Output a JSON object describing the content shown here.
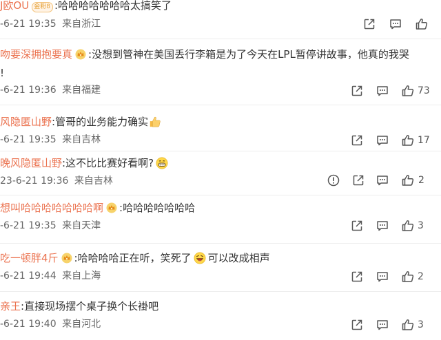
{
  "comments": [
    {
      "username": "J欧OU",
      "badge": "金粉8",
      "text": ":哈哈哈哈哈哈哈太搞笑了",
      "text_after_emoji": "",
      "emoji": "",
      "continuation": "",
      "time": "-6-21 19:35",
      "location": "来自浙江",
      "likes": ""
    },
    {
      "username": "吻要深拥抱要真",
      "badge": "",
      "text": ":没想到管神在美国丢行李箱是为了今天在LPL暂停讲故事，他真的我哭",
      "text_after_emoji": "",
      "emoji": "",
      "continuation": "!",
      "time": "-6-21 19:36",
      "location": "来自福建",
      "likes": "73"
    },
    {
      "username": "风隐匿山野",
      "badge": "",
      "text": ":管哥的业务能力确实",
      "text_after_emoji": "",
      "emoji": "thumbs-up",
      "continuation": "",
      "time": "-6-21 19:35",
      "location": "来自吉林",
      "likes": "17"
    },
    {
      "username": "晚风隐匿山野",
      "badge": "",
      "text": ":这不比比赛好看啊?",
      "text_after_emoji": "",
      "emoji": "grin",
      "continuation": "",
      "time": "23-6-21 19:36",
      "location": "来自吉林",
      "likes": "2"
    },
    {
      "username": "想叫哈哈哈哈哈哈哈啊",
      "badge": "",
      "text": ":哈哈哈哈哈哈哈",
      "text_after_emoji": "",
      "emoji": "",
      "continuation": "",
      "time": "-6-21 19:35",
      "location": "来自天津",
      "likes": "3"
    },
    {
      "username": "吃一顿胖4斤",
      "badge": "",
      "text": ":哈哈哈哈正在听，笑死了",
      "text_after_emoji": "可以改成相声",
      "emoji": "laugh",
      "continuation": "",
      "time": "-6-21 19:44",
      "location": "来自上海",
      "likes": "2"
    },
    {
      "username": "亲王",
      "badge": "",
      "text": ":直接现场摆个桌子换个长褂吧",
      "text_after_emoji": "",
      "emoji": "",
      "continuation": "",
      "time": "-6-21 19:40",
      "location": "来自河北",
      "likes": "3"
    }
  ],
  "icons": {
    "report": "report-icon",
    "share": "share-icon",
    "comment": "comment-icon",
    "like": "like-icon"
  },
  "colors": {
    "username": "#eb7350",
    "badge_bg": "#fff3e5",
    "badge_text": "#e6a238"
  }
}
